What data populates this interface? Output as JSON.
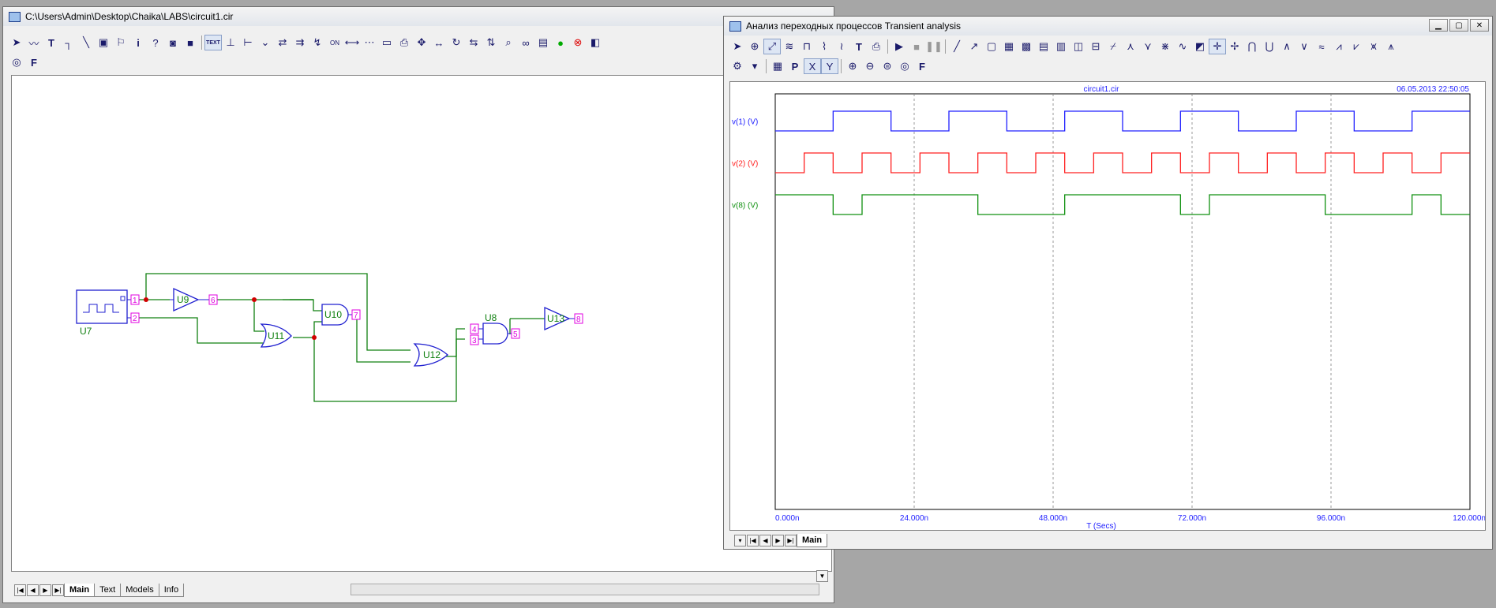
{
  "schematic": {
    "title": "C:\\Users\\Admin\\Desktop\\Chaika\\LABS\\circuit1.cir",
    "toolbar_text_1": "TEXT",
    "toolbar_text_2": "ON",
    "tabs": [
      "Main",
      "Text",
      "Models",
      "Info"
    ],
    "components": {
      "u7": "U7",
      "u9": "U9",
      "u10": "U10",
      "u11": "U11",
      "u12": "U12",
      "u8": "U8",
      "u13": "U13"
    },
    "nodes": {
      "n1": "1",
      "n2": "2",
      "n6": "6",
      "n7": "7",
      "n4": "4",
      "n3": "3",
      "n5": "5",
      "n8": "8"
    }
  },
  "analysis": {
    "title": "Анализ переходных процессов Transient analysis",
    "plot_title": "circuit1.cir",
    "timestamp": "06.05.2013 22:50:05",
    "tab": "Main",
    "colors": {
      "v1": "#2020ff",
      "v2": "#ff2020",
      "v8": "#109010",
      "grid": "#808080",
      "label": "#2020ff"
    }
  },
  "chart_data": {
    "type": "line",
    "title": "circuit1.cir",
    "xlabel": "T (Secs)",
    "xlim": [
      0,
      120
    ],
    "x_unit": "ns",
    "x_tick_labels": [
      "0.000n",
      "24.000n",
      "48.000n",
      "72.000n",
      "96.000n",
      "120.000n"
    ],
    "series": [
      {
        "name": "v(1) (V)",
        "levels": "digital 0/1",
        "transitions_ns": [
          0,
          10,
          20,
          30,
          40,
          50,
          60,
          70,
          80,
          90,
          100,
          110,
          120
        ],
        "values": [
          0,
          1,
          0,
          1,
          0,
          1,
          0,
          1,
          0,
          1,
          0,
          1
        ]
      },
      {
        "name": "v(2) (V)",
        "levels": "digital 0/1",
        "transitions_ns": [
          0,
          5,
          10,
          15,
          20,
          25,
          30,
          35,
          40,
          45,
          50,
          55,
          60,
          65,
          70,
          75,
          80,
          85,
          90,
          95,
          100,
          105,
          110,
          115,
          120
        ],
        "values": [
          0,
          1,
          0,
          1,
          0,
          1,
          0,
          1,
          0,
          1,
          0,
          1,
          0,
          1,
          0,
          1,
          0,
          1,
          0,
          1,
          0,
          1,
          0,
          1
        ]
      },
      {
        "name": "v(8) (V)",
        "levels": "digital 0/1",
        "transitions_ns": [
          0,
          10,
          15,
          30,
          35,
          50,
          55,
          70,
          75,
          90,
          95,
          110,
          115,
          120
        ],
        "values": [
          1,
          0,
          1,
          1,
          0,
          1,
          1,
          0,
          1,
          1,
          0,
          1,
          0
        ]
      }
    ]
  }
}
